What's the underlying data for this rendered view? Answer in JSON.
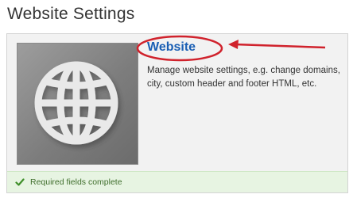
{
  "page": {
    "title": "Website Settings"
  },
  "card": {
    "link_label": "Website",
    "description": "Manage website settings, e.g. change domains, city, custom header and footer HTML, etc.",
    "thumbnail_icon": "globe-icon"
  },
  "status": {
    "icon": "check-icon",
    "text": "Required fields complete"
  },
  "colors": {
    "link": "#1a5fb4",
    "annotation": "#d0222c",
    "status_bg": "#e7f4e2",
    "status_text": "#3f6e2c"
  }
}
